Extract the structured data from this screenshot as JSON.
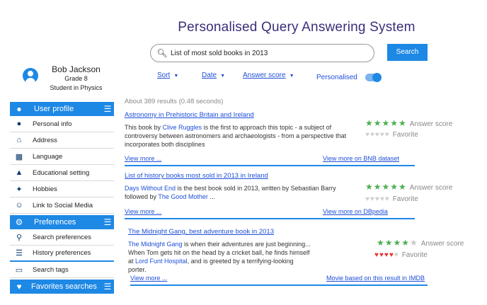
{
  "app": {
    "title": "Personalised Query Answering System"
  },
  "search": {
    "query": "List of most sold books in 2013",
    "button_label": "Search"
  },
  "filters": {
    "sort": "Sort",
    "date": "Date",
    "answer_score": "Answer score",
    "personalised": "Personalised",
    "personalised_on": true
  },
  "results_count": "About 389 results (0.48 seconds)",
  "profile": {
    "name": "Bob Jackson",
    "grade": "Grade 8",
    "role": "Student in Physics"
  },
  "sidebar": {
    "user_profile": {
      "label": "User profile",
      "items": [
        {
          "label": "Personal info",
          "icon": "person-icon"
        },
        {
          "label": "Address",
          "icon": "home-icon"
        },
        {
          "label": "Language",
          "icon": "translate-icon"
        },
        {
          "label": "Educational setting",
          "icon": "graduation-cap-icon"
        },
        {
          "label": "Hobbies",
          "icon": "puzzle-icon"
        },
        {
          "label": "Link to Social Media",
          "icon": "social-media-icon"
        }
      ]
    },
    "preferences": {
      "label": "Preferences",
      "items": [
        {
          "label": "Search preferences",
          "icon": "search-icon"
        },
        {
          "label": "History preferences",
          "icon": "list-icon"
        },
        {
          "label": "Search tags",
          "icon": "monitor-icon"
        }
      ]
    },
    "favorites": {
      "label": "Favorites searches"
    }
  },
  "results": [
    {
      "title": "Astronomy in Prehistoric Britain and Ireland",
      "desc_pre": "This book by ",
      "desc_hl1": "Clive Ruggles",
      "desc_post": " is the first to approach this topic - a subject of controversy between astronomers and archaeologists - from a perspective that incorporates both disciplines",
      "view_more": "View more ...",
      "source_link": "View more on BNB dataset",
      "answer_score_stars": 5,
      "favorite_hearts": 0,
      "answer_score_label": "Answer score",
      "favorite_label": "Favorite"
    },
    {
      "title": "List of history books most sold in 2013 in Ireland",
      "desc_hl1": "Days Without End",
      "desc_mid": " is the best book sold in 2013, written by Sebastian Barry followed by ",
      "desc_hl2": "The Good Mother",
      "desc_post": " ...",
      "view_more": "View more ...",
      "source_link": "View more on DBpedia",
      "answer_score_stars": 5,
      "favorite_hearts": 0,
      "answer_score_label": "Answer score",
      "favorite_label": "Favorite"
    },
    {
      "title": "The Midnight Gang, best adventure book in 2013",
      "desc_hl1": "The Midnight Gang",
      "desc_mid": " is when their adventures are just beginning... When Tom gets hit on the head by a cricket ball, he finds himself at ",
      "desc_hl2": "Lord Funt Hospital",
      "desc_post": ", and is greeted by a terrifying-looking porter.",
      "view_more": "View more ...",
      "source_link": "Movie based on this result in IMDB",
      "answer_score_stars": 4,
      "favorite_hearts": 4,
      "answer_score_label": "Answer score",
      "favorite_label": "Favorite"
    }
  ]
}
